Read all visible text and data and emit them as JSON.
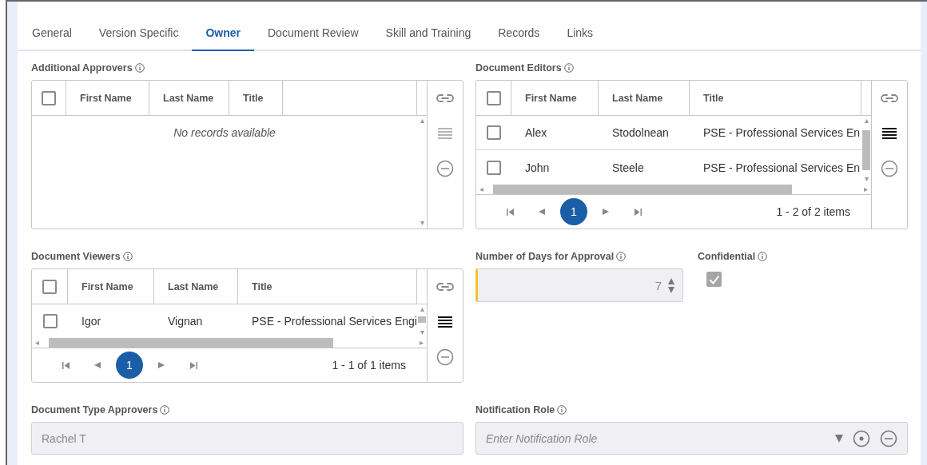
{
  "tabs": [
    {
      "label": "General",
      "selected": false
    },
    {
      "label": "Version Specific",
      "selected": false
    },
    {
      "label": "Owner",
      "selected": true
    },
    {
      "label": "Document Review",
      "selected": false
    },
    {
      "label": "Skill and Training",
      "selected": false
    },
    {
      "label": "Records",
      "selected": false
    },
    {
      "label": "Links",
      "selected": false
    }
  ],
  "additional_approvers": {
    "label": "Additional Approvers",
    "select_all_checked": false,
    "columns": [
      "First Name",
      "Last Name",
      "Title"
    ],
    "empty_message": "No records available",
    "actions": [
      {
        "kind": "link",
        "disabled": false
      },
      {
        "kind": "list",
        "disabled": true
      },
      {
        "kind": "remove",
        "disabled": false
      }
    ]
  },
  "document_editors": {
    "label": "Document Editors",
    "select_all_checked": false,
    "columns": [
      "First Name",
      "Last Name",
      "Title"
    ],
    "rows": [
      {
        "first_name": "Alex",
        "last_name": "Stodolnean",
        "title": "PSE - Professional Services En",
        "checked": false
      },
      {
        "first_name": "John",
        "last_name": "Steele",
        "title": "PSE - Professional Services En",
        "checked": false
      }
    ],
    "pager": {
      "page": "1",
      "summary": "1 - 2 of 2 items"
    },
    "actions": [
      {
        "kind": "link",
        "disabled": false
      },
      {
        "kind": "list",
        "disabled": false
      },
      {
        "kind": "remove",
        "disabled": false
      }
    ]
  },
  "document_viewers": {
    "label": "Document Viewers",
    "select_all_checked": false,
    "columns": [
      "First Name",
      "Last Name",
      "Title"
    ],
    "rows": [
      {
        "first_name": "Igor",
        "last_name": "Vignan",
        "title": "PSE - Professional Services Engi",
        "checked": false
      }
    ],
    "pager": {
      "page": "1",
      "summary": "1 - 1 of 1 items"
    },
    "actions": [
      {
        "kind": "link",
        "disabled": false
      },
      {
        "kind": "list",
        "disabled": false
      },
      {
        "kind": "remove",
        "disabled": false
      }
    ]
  },
  "days_for_approval": {
    "label": "Number of Days for Approval",
    "value": "7"
  },
  "confidential": {
    "label": "Confidential",
    "checked": true
  },
  "document_type_approvers": {
    "label": "Document Type Approvers",
    "value": "Rachel T"
  },
  "notification_role": {
    "label": "Notification Role",
    "placeholder": "Enter Notification Role"
  }
}
